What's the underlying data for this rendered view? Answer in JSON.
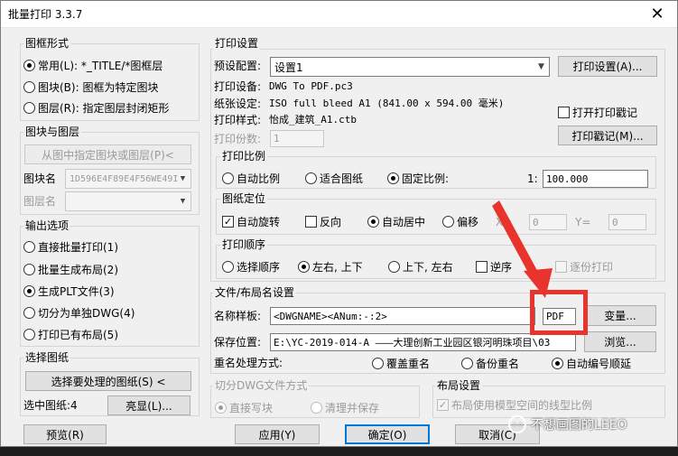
{
  "window": {
    "title": "批量打印 3.3.7",
    "close_glyph": "✕"
  },
  "frame_form": {
    "title": "图框形式",
    "options": [
      {
        "label": "常用(L): *_TITLE/*图框层",
        "selected": true
      },
      {
        "label": "图块(B): 图框为特定图块",
        "selected": false
      },
      {
        "label": "图层(R): 指定图层封闭矩形",
        "selected": false
      }
    ]
  },
  "block_layer": {
    "title": "图块与图层",
    "pick_button": "从图中指定图块或图层(P)<",
    "block_name_label": "图块名",
    "block_name_value": "1D596E4F89E4F56WE49I",
    "layer_name_label": "图层名"
  },
  "output": {
    "title": "输出选项",
    "options": [
      {
        "label": "直接批量打印(1)",
        "selected": false
      },
      {
        "label": "批量生成布局(2)",
        "selected": false
      },
      {
        "label": "生成PLT文件(3)",
        "selected": true
      },
      {
        "label": "切分为单独DWG(4)",
        "selected": false
      },
      {
        "label": "打印已有布局(5)",
        "selected": false
      }
    ]
  },
  "select_drawings": {
    "title": "选择图纸",
    "select_button": "选择要处理的图纸(S) <",
    "selected_count": "选中图纸:4",
    "highlight_button": "亮显(L)..."
  },
  "print_settings": {
    "title": "打印设置",
    "preset_label": "预设配置:",
    "preset_value": "设置1",
    "print_setup_button": "打印设置(A)...",
    "device_label": "打印设备:",
    "device_value": "DWG To PDF.pc3",
    "paper_label": "纸张设定:",
    "paper_value": "ISO full bleed A1 (841.00 x 594.00 毫米)",
    "style_label": "打印样式:",
    "style_value": "怡成_建筑_A1.ctb",
    "stamp_checkbox": "打开打印戳记",
    "stamp_checked": false,
    "copies_label": "打印份数:",
    "copies_value": "1",
    "stamp_button": "打印戳记(M)..."
  },
  "scale": {
    "title": "打印比例",
    "options": [
      {
        "label": "自动比例",
        "selected": false
      },
      {
        "label": "适合图纸",
        "selected": false
      },
      {
        "label": "固定比例:",
        "selected": true
      }
    ],
    "ratio_prefix": "1:",
    "ratio_value": "100.000"
  },
  "position": {
    "title": "图纸定位",
    "auto_rotate": "自动旋转",
    "auto_rotate_checked": true,
    "reverse": "反向",
    "reverse_checked": false,
    "options": [
      {
        "label": "自动居中",
        "selected": true
      },
      {
        "label": "偏移",
        "selected": false
      }
    ],
    "x_label": "X=",
    "x_value": "0",
    "y_label": "Y=",
    "y_value": "0"
  },
  "order": {
    "title": "打印顺序",
    "options": [
      {
        "label": "选择顺序",
        "selected": false
      },
      {
        "label": "左右, 上下",
        "selected": true
      },
      {
        "label": "上下, 左右",
        "selected": false
      }
    ],
    "reverse": "逆序",
    "reverse_checked": false,
    "one_by_one": "逐份打印",
    "one_by_one_checked": false
  },
  "file_naming": {
    "title": "文件/布局名设置",
    "template_label": "名称样板:",
    "template_value": "<DWGNAME><ANum:-:2>",
    "ext_value": "PDF",
    "change_button": "变量...",
    "save_label": "保存位置:",
    "save_value": "E:\\YC-2019-014-A  ———大理创新工业园区银河明珠项目\\03",
    "browse_button": "浏览...",
    "dup_label": "重名处理方式:",
    "dup_options": [
      {
        "label": "覆盖重名",
        "selected": false
      },
      {
        "label": "备份重名",
        "selected": false
      },
      {
        "label": "自动编号顺延",
        "selected": true
      }
    ]
  },
  "split_dwg": {
    "title": "切分DWG文件方式",
    "options": [
      {
        "label": "直接写块",
        "selected": true
      },
      {
        "label": "清理并保存",
        "selected": false
      }
    ]
  },
  "layout_settings": {
    "title": "布局设置",
    "checkbox": "布局使用模型空间的线型比例",
    "checked": true
  },
  "bottom": {
    "preview": "预览(R)",
    "apply": "应用(Y)",
    "ok": "确定(O)",
    "cancel": "取消(C)"
  },
  "watermark": {
    "text": "不想画图的LEEO"
  },
  "colors": {
    "annotation_red": "#e8342c",
    "focus_blue": "#0078d7"
  }
}
